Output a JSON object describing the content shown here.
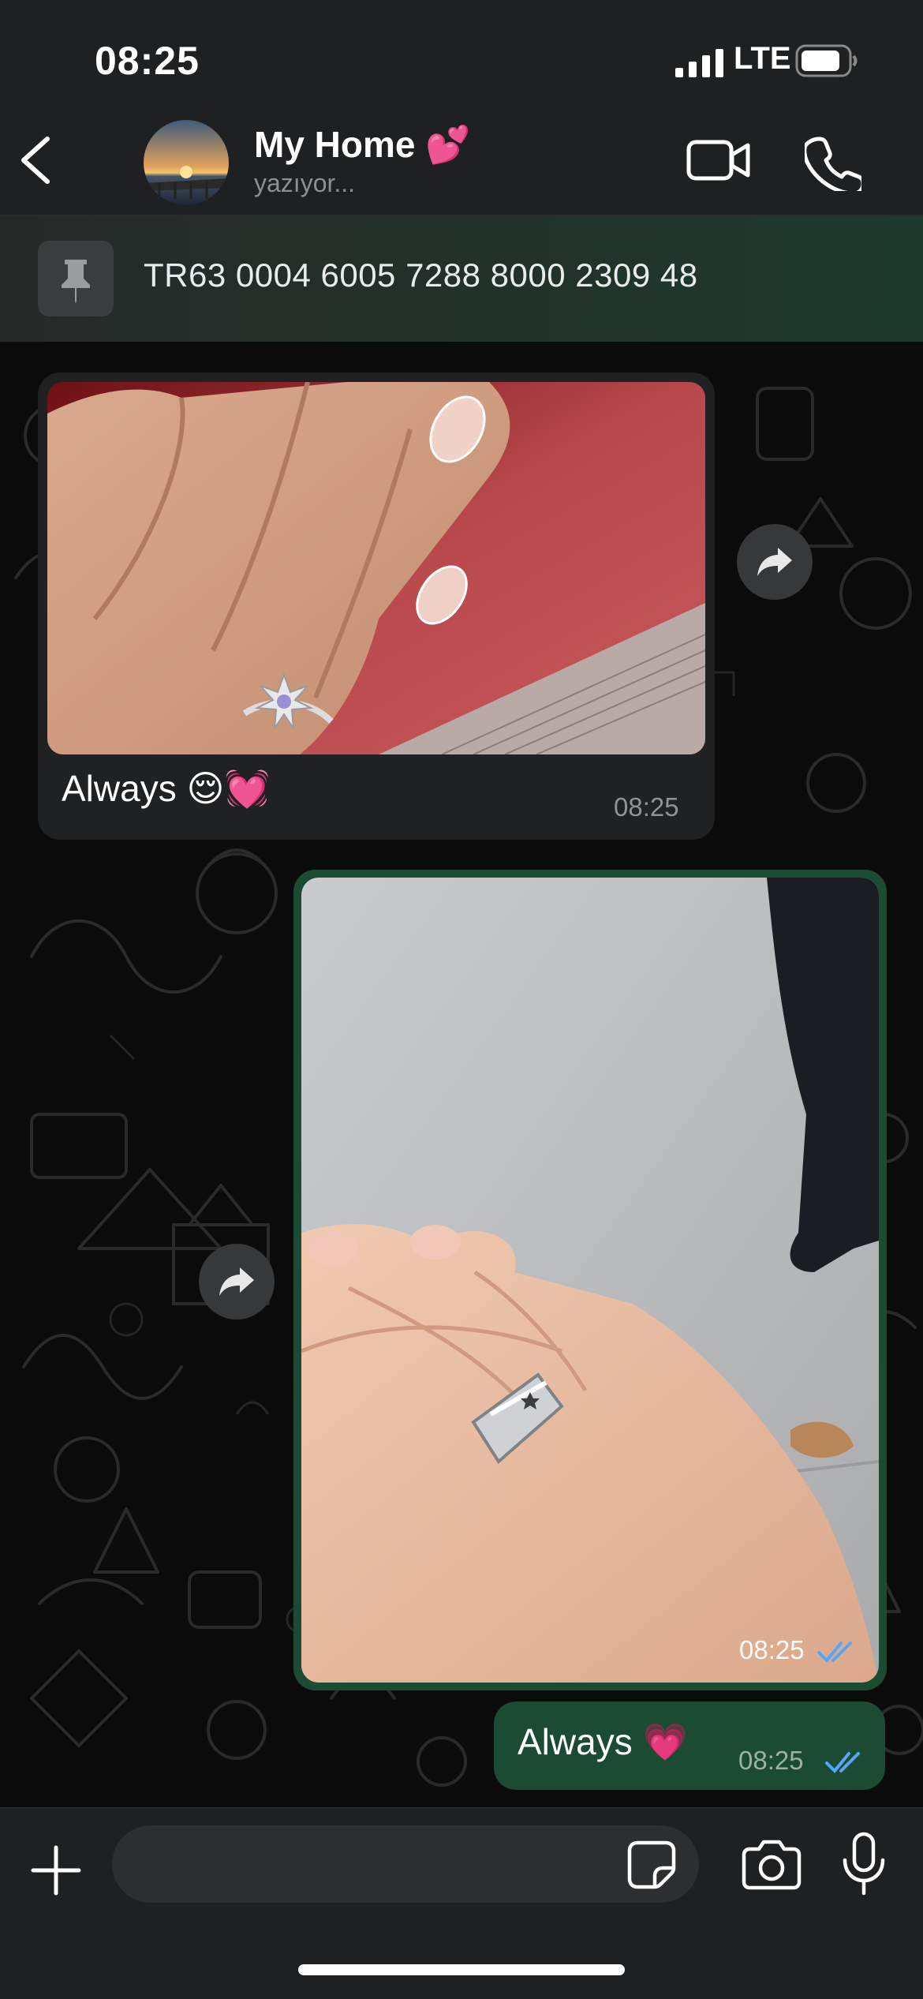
{
  "status_bar": {
    "time": "08:25",
    "network": "LTE",
    "icons": [
      "signal-icon",
      "battery-icon"
    ]
  },
  "header": {
    "contact_name": "My Home 💕",
    "status": "yazıyor...",
    "icons": [
      "back-arrow-icon",
      "video-call-icon",
      "phone-icon"
    ]
  },
  "pinned_message": {
    "text": "TR63 0004 6005 7288 8000 2309 48",
    "icon": "pin-icon"
  },
  "messages": [
    {
      "direction": "incoming",
      "type": "image",
      "caption": "Always 😌💓",
      "time": "08:25"
    },
    {
      "direction": "outgoing",
      "type": "image",
      "time": "08:25",
      "status": "read"
    },
    {
      "direction": "outgoing",
      "type": "text",
      "text": "Always 💗",
      "time": "08:25",
      "status": "read"
    }
  ],
  "composer": {
    "placeholder": "",
    "icons": [
      "plus-icon",
      "sticker-icon",
      "camera-icon",
      "microphone-icon"
    ]
  },
  "colors": {
    "background": "#0b0b0b",
    "header": "#1f2021",
    "incoming_bubble": "#1f2123",
    "outgoing_bubble": "#1c4b33",
    "read_ticks": "#53a6fd",
    "secondary_text": "#8d8f93"
  }
}
